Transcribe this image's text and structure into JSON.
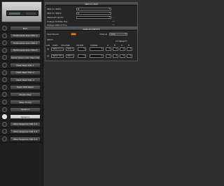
{
  "device": {
    "label": ""
  },
  "sidebar": {
    "items": [
      {
        "label": "Main",
        "icon": "main-icon",
        "selected": false
      },
      {
        "label": "Performance Euro XS/L 1",
        "icon": "performance-icon",
        "selected": false
      },
      {
        "label": "Performance Euro XS/L 2",
        "icon": "performance-icon",
        "selected": false
      },
      {
        "label": "Performance Euro XS/L 3",
        "icon": "performance-icon",
        "selected": false
      },
      {
        "label": "Global Options (Not Patch XS)",
        "icon": "global-icon",
        "selected": false
      },
      {
        "label": "Patch Bank XS/L 1",
        "icon": "patch-icon",
        "selected": false
      },
      {
        "label": "Patch Bank XS/L 2",
        "icon": "patch-icon",
        "selected": false
      },
      {
        "label": "Patch Bank XS/L 3",
        "icon": "patch-icon",
        "selected": false
      },
      {
        "label": "Patch XRS Select",
        "icon": "patch-icon",
        "selected": false
      },
      {
        "label": "Rhythm Map",
        "icon": "rhythm-icon",
        "selected": false
      },
      {
        "label": "Wave Tuning",
        "icon": "wave-icon",
        "selected": false
      },
      {
        "label": "System 1",
        "icon": "system-icon",
        "selected": false
      },
      {
        "label": "System 2",
        "icon": "system-icon",
        "selected": true
      },
      {
        "label": "Wave Sequence XS/L 1-1",
        "icon": "wave-seq-icon",
        "selected": false
      },
      {
        "label": "Wave Sequence XS/L 1-2",
        "icon": "wave-seq-icon",
        "selected": false
      },
      {
        "label": "Wave Sequence XS/L 1-3",
        "icon": "wave-seq-icon",
        "selected": false
      }
    ]
  },
  "midi_cc_map": {
    "title": "MIDI CC MAP",
    "rows": [
      {
        "label": "MIDI CC SWT1",
        "value": "S"
      },
      {
        "label": "MIDI CC SWT2",
        "value": "S"
      },
      {
        "label": "Aftertouch via CC",
        "value": ""
      },
      {
        "label": "Change CC/Filter Pnp",
        "value": ""
      },
      {
        "label": "Change Multi FX Pnp",
        "value": ""
      }
    ]
  },
  "analog_inputs": {
    "title": "ANALOG INPUTS",
    "input_source_label": "Input Source",
    "channel_label": "Channel",
    "channel_value": "CHS",
    "gain_label": "INPUT",
    "headers": {
      "left": [
        "A/B",
        "GAIN",
        "VOLUME",
        "FILTER",
        "SCENE"
      ],
      "right_title": "FX SELECT",
      "right": [
        "A",
        "B",
        "C",
        "D"
      ]
    },
    "rows": [
      {
        "name": "INPUT A",
        "value": "OFF"
      },
      {
        "name": "INPUT B",
        "value": "OFF"
      }
    ]
  },
  "colors": {
    "accent": "#f08020",
    "selected_bg": "#e0e0e0"
  }
}
